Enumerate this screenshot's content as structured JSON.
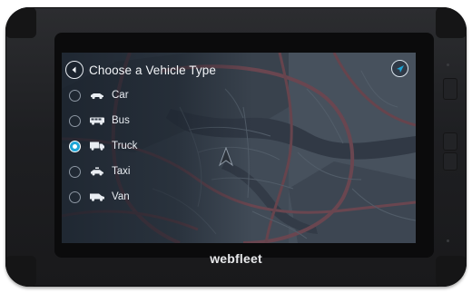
{
  "screen": {
    "title": "Choose a Vehicle Type",
    "selected": "Truck",
    "options": [
      {
        "label": "Car",
        "icon": "car-icon",
        "checked": false
      },
      {
        "label": "Bus",
        "icon": "bus-icon",
        "checked": false
      },
      {
        "label": "Truck",
        "icon": "truck-icon",
        "checked": true
      },
      {
        "label": "Taxi",
        "icon": "taxi-icon",
        "checked": false
      },
      {
        "label": "Van",
        "icon": "van-icon",
        "checked": false
      }
    ]
  },
  "device": {
    "brand": "webfleet"
  },
  "colors": {
    "accent": "#1ea5d6",
    "text": "#e9edf2",
    "map_background": "#3b4450"
  }
}
